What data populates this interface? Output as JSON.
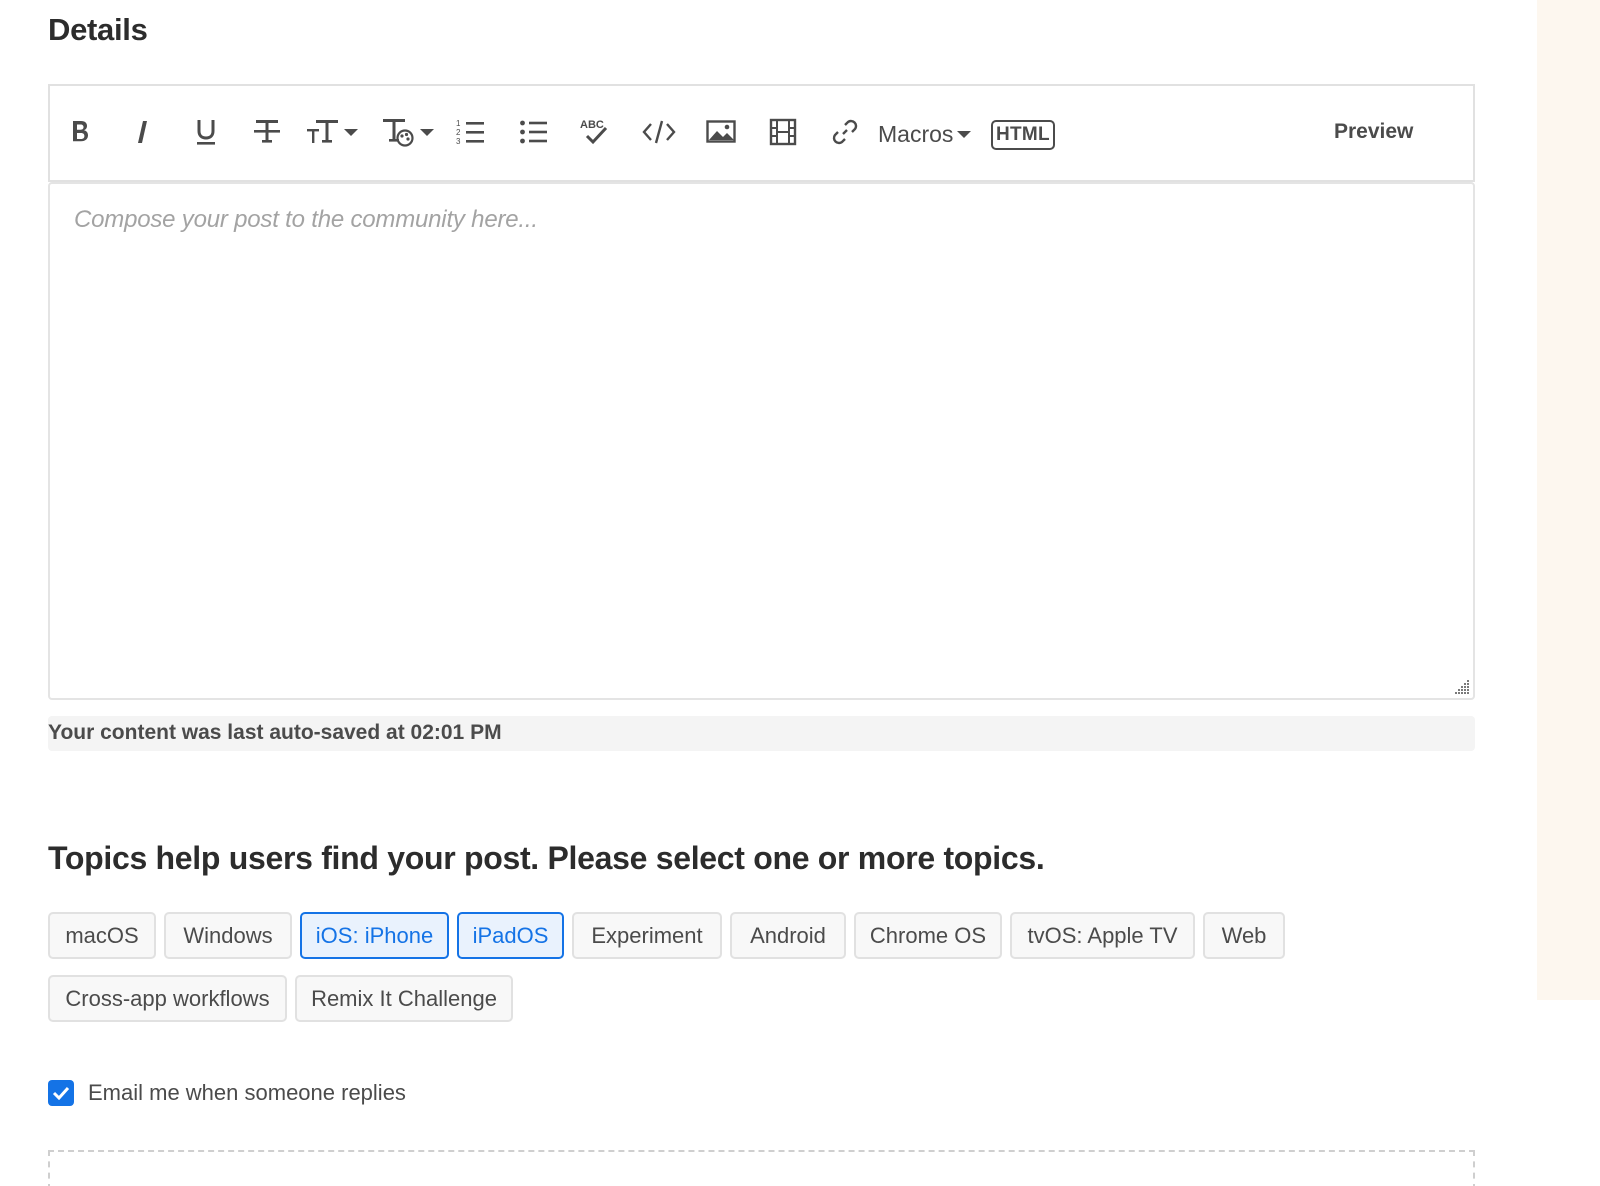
{
  "details": {
    "title": "Details"
  },
  "toolbar": {
    "macros_label": "Macros",
    "html_label": "HTML",
    "preview_label": "Preview",
    "abc_label": "ABC",
    "icons": [
      "bold-icon",
      "italic-icon",
      "underline-icon",
      "strikethrough-icon",
      "font-size-icon",
      "text-color-icon",
      "ordered-list-icon",
      "unordered-list-icon",
      "spellcheck-icon",
      "code-icon",
      "image-icon",
      "video-icon",
      "link-icon"
    ]
  },
  "editor": {
    "placeholder": "Compose your post to the community here..."
  },
  "autosave": {
    "text": "Your content was last auto-saved at 02:01 PM"
  },
  "topics": {
    "title": "Topics help users find your post. Please select one or more topics.",
    "chips": [
      {
        "label": "macOS",
        "selected": false
      },
      {
        "label": "Windows",
        "selected": false
      },
      {
        "label": "iOS: iPhone",
        "selected": true
      },
      {
        "label": "iPadOS",
        "selected": true
      },
      {
        "label": "Experiment",
        "selected": false
      },
      {
        "label": "Android",
        "selected": false
      },
      {
        "label": "Chrome OS",
        "selected": false
      },
      {
        "label": "tvOS: Apple TV",
        "selected": false
      },
      {
        "label": "Web",
        "selected": false
      },
      {
        "label": "Cross-app workflows",
        "selected": false
      },
      {
        "label": "Remix It Challenge",
        "selected": false
      }
    ]
  },
  "email": {
    "label": "Email me when someone replies",
    "checked": true
  },
  "colors": {
    "accent": "#1473e6",
    "text": "#4b4b4b",
    "heading": "#2c2c2c"
  }
}
